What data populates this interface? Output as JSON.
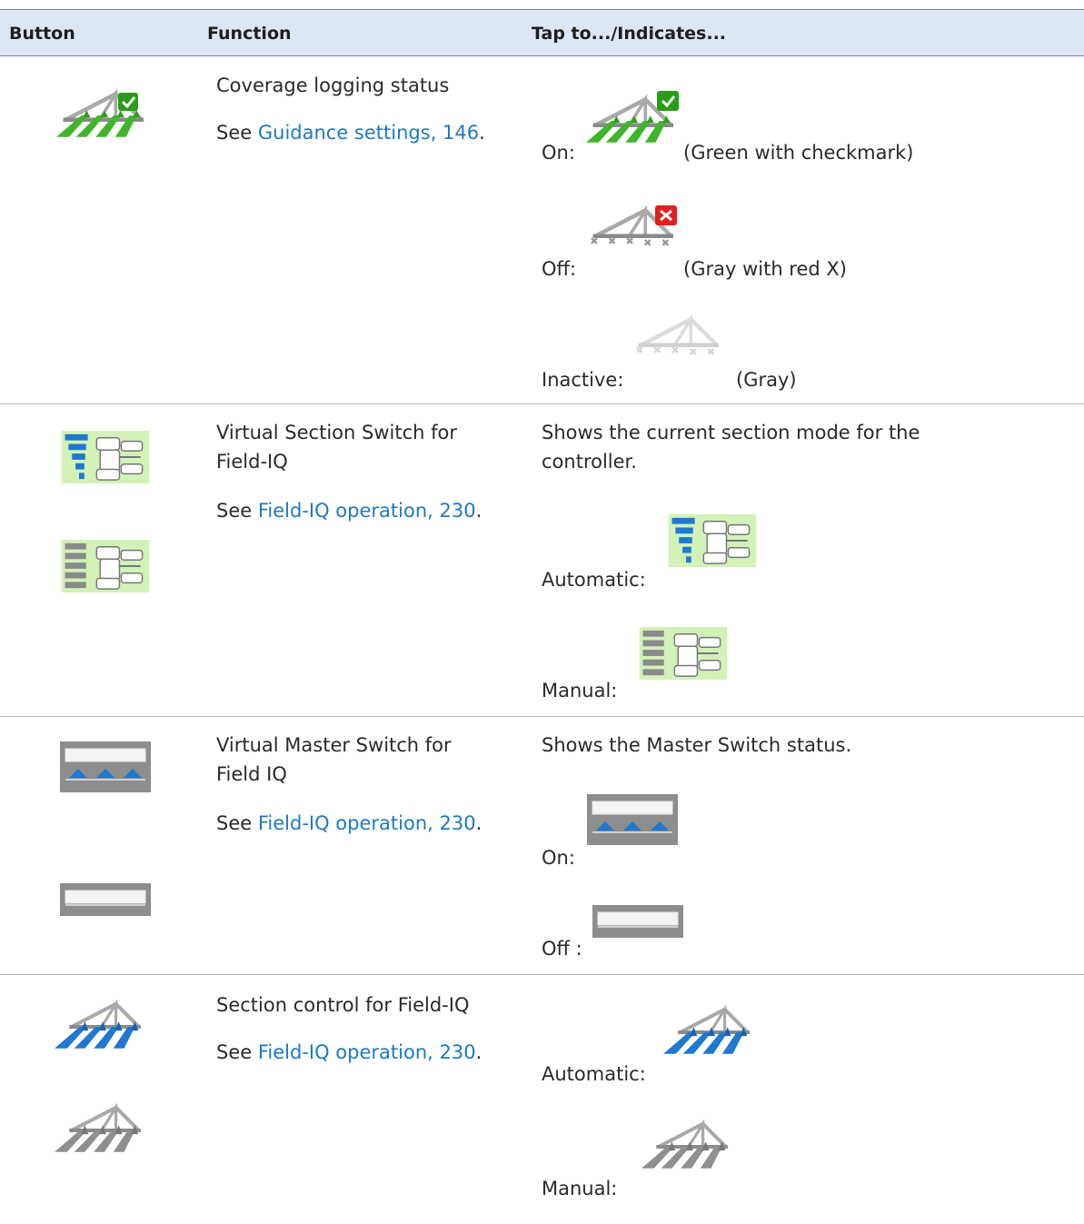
{
  "table": {
    "headers": {
      "button": "Button",
      "function": "Function",
      "tap": "Tap to.../Indicates..."
    },
    "rows": [
      {
        "function_title": "Coverage logging status",
        "see_prefix": "See ",
        "link": "Guidance settings, 146",
        "link_suffix": ".",
        "states": [
          {
            "label": "On:",
            "note": "(Green with checkmark)",
            "icon": "coverage-on-icon"
          },
          {
            "label": "Off:",
            "note": "(Gray with red X)",
            "icon": "coverage-off-icon"
          },
          {
            "label": "Inactive:",
            "note": "(Gray)",
            "icon": "coverage-inactive-icon"
          }
        ]
      },
      {
        "function_title_1": "Virtual Section Switch for",
        "function_title_2": "Field-IQ",
        "see_prefix": "See ",
        "link": "Field-IQ operation, 230",
        "link_suffix": ".",
        "desc_1": "Shows the current section mode for the",
        "desc_2": "controller.",
        "states": [
          {
            "label": "Automatic:",
            "icon": "section-switch-automatic-icon"
          },
          {
            "label": "Manual:",
            "icon": "section-switch-manual-icon"
          }
        ]
      },
      {
        "function_title_1": "Virtual Master Switch for",
        "function_title_2": "Field IQ",
        "see_prefix": "See ",
        "link": "Field-IQ operation, 230",
        "link_suffix": ".",
        "desc": "Shows the Master Switch status.",
        "states": [
          {
            "label": "On:",
            "icon": "master-switch-on-icon"
          },
          {
            "label": "Off :",
            "icon": "master-switch-off-icon"
          }
        ]
      },
      {
        "function_title": "Section control for Field-IQ",
        "see_prefix": "See ",
        "link": "Field-IQ operation, 230",
        "link_suffix": ".",
        "states": [
          {
            "label": "Automatic:",
            "icon": "section-control-automatic-icon"
          },
          {
            "label": "Manual:",
            "icon": "section-control-manual-icon"
          }
        ]
      }
    ]
  },
  "colors": {
    "header_bg": "#dde6f3",
    "header_border": "#6f86b5",
    "link": "#1f79c2",
    "green": "#3fb52a",
    "blue": "#1f78d1",
    "gray": "#8f8f8f",
    "red": "#e02020",
    "panel_green": "#d2f2b8"
  }
}
